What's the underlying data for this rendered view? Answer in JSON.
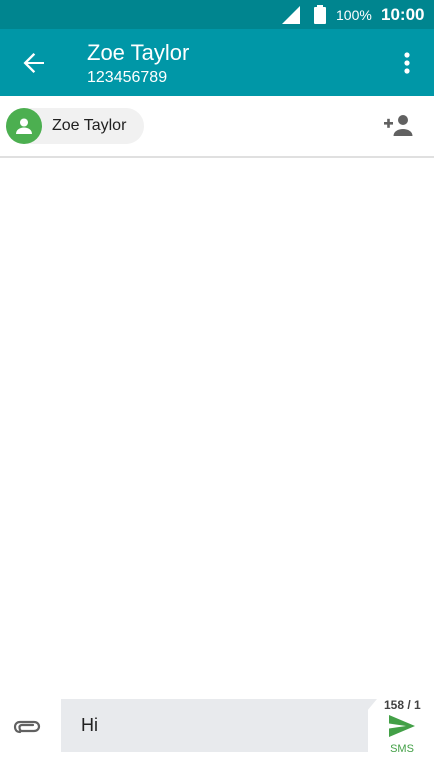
{
  "status_bar": {
    "battery_percent": "100%",
    "time": "10:00",
    "icons": [
      "cellular-signal-icon",
      "battery-icon"
    ]
  },
  "header": {
    "contact_name": "Zoe Taylor",
    "phone_number": "123456789",
    "icons": [
      "back-arrow-icon",
      "more-vertical-icon"
    ]
  },
  "recipients": {
    "chips": [
      {
        "label": "Zoe Taylor",
        "avatar_color": "#4caf50"
      }
    ],
    "icons": [
      "add-contact-icon"
    ]
  },
  "compose": {
    "value": "Hi",
    "counter": "158 / 1",
    "send_label": "SMS",
    "icons": [
      "attach-icon",
      "send-icon"
    ]
  },
  "colors": {
    "status_bar": "#00858f",
    "app_bar": "#0097a7",
    "send_accent": "#43a047",
    "compose_background": "#e8eaed"
  }
}
